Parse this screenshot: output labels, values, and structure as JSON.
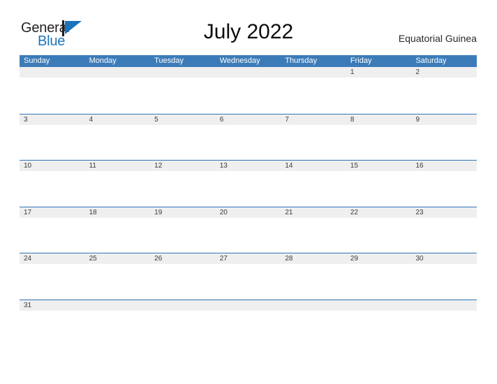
{
  "brand": {
    "name_part1": "General",
    "name_part2": "Blue",
    "mark_icon": "triangle-flag-icon",
    "color_primary": "#1b74bb",
    "color_text": "#231f20"
  },
  "header": {
    "title": "July 2022",
    "locale": "Equatorial Guinea"
  },
  "calendar": {
    "accent_color": "#3b7cb8",
    "band_color": "#efefef",
    "border_color": "#2e74b5",
    "weekdays": [
      "Sunday",
      "Monday",
      "Tuesday",
      "Wednesday",
      "Thursday",
      "Friday",
      "Saturday"
    ],
    "weeks": [
      [
        "",
        "",
        "",
        "",
        "",
        "1",
        "2"
      ],
      [
        "3",
        "4",
        "5",
        "6",
        "7",
        "8",
        "9"
      ],
      [
        "10",
        "11",
        "12",
        "13",
        "14",
        "15",
        "16"
      ],
      [
        "17",
        "18",
        "19",
        "20",
        "21",
        "22",
        "23"
      ],
      [
        "24",
        "25",
        "26",
        "27",
        "28",
        "29",
        "30"
      ],
      [
        "31",
        "",
        "",
        "",
        "",
        "",
        ""
      ]
    ]
  }
}
